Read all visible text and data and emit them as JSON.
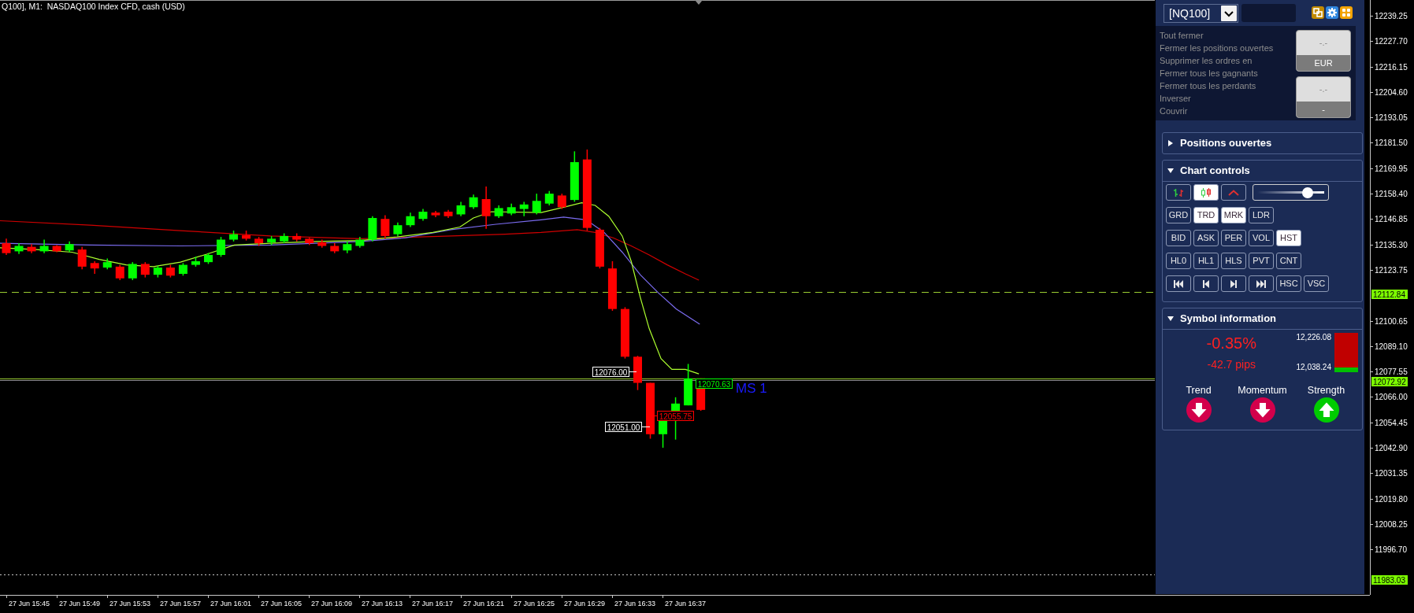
{
  "chart": {
    "title": "Q100], M1:  NASDAQ100 Index CFD, cash (USD)",
    "tags": [
      {
        "text": "12076.00",
        "color": "#ffffff"
      },
      {
        "text": "12051.00",
        "color": "#ffffff"
      },
      {
        "text": "12055.75",
        "color": "#ff0000"
      },
      {
        "text": "12070.63",
        "color": "#00ff00"
      }
    ],
    "line_label": "MS 1",
    "levels": [
      {
        "kind": "dashed",
        "marker": "12112.84"
      },
      {
        "kind": "solid",
        "marker": "12072.92"
      },
      {
        "kind": "dotted",
        "marker": "11983.03"
      }
    ],
    "price_ticks": [
      "12239.25",
      "12227.70",
      "12216.15",
      "12204.60",
      "12193.05",
      "12181.50",
      "12169.95",
      "12158.40",
      "12146.85",
      "12135.30",
      "12123.75",
      "12100.65",
      "12089.10",
      "12077.55",
      "12066.00",
      "12054.45",
      "12042.90",
      "12031.35",
      "12019.80",
      "12008.25",
      "11996.70"
    ],
    "time_ticks": [
      "27 Jun 15:45",
      "27 Jun 15:49",
      "27 Jun 15:53",
      "27 Jun 15:57",
      "27 Jun 16:01",
      "27 Jun 16:05",
      "27 Jun 16:09",
      "27 Jun 16:13",
      "27 Jun 16:17",
      "27 Jun 16:21",
      "27 Jun 16:25",
      "27 Jun 16:29",
      "27 Jun 16:33",
      "27 Jun 16:37"
    ]
  },
  "panel": {
    "symbol": "[NQ100]",
    "actions": [
      "Tout fermer",
      "Fermer les positions ouvertes",
      "Supprimer les ordres en",
      "Fermer tous les gagnants",
      "Fermer tous les perdants",
      "Inverser",
      "Couvrir"
    ],
    "amount_buttons": [
      {
        "value": "-.-",
        "caption": "EUR"
      },
      {
        "value": "-.-",
        "caption": "-"
      }
    ],
    "positions": {
      "title": "Positions ouvertes",
      "expanded": false
    },
    "chart_controls": {
      "title": "Chart controls",
      "expanded": true,
      "chart_types": [
        {
          "kind": "bars",
          "selected": false
        },
        {
          "kind": "candles",
          "selected": true
        },
        {
          "kind": "line",
          "selected": false
        }
      ],
      "zoom": {
        "level": 0.75
      },
      "toggle_rows": [
        [
          {
            "label": "GRD",
            "selected": false
          },
          {
            "label": "TRD",
            "selected": true
          },
          {
            "label": "MRK",
            "selected": true
          },
          {
            "label": "LDR",
            "selected": false
          }
        ],
        [
          {
            "label": "BID",
            "selected": false
          },
          {
            "label": "ASK",
            "selected": false
          },
          {
            "label": "PER",
            "selected": false
          },
          {
            "label": "VOL",
            "selected": false
          },
          {
            "label": "HST",
            "selected": true
          }
        ],
        [
          {
            "label": "HL0",
            "selected": false
          },
          {
            "label": "HL1",
            "selected": false
          },
          {
            "label": "HLS",
            "selected": false
          },
          {
            "label": "PVT",
            "selected": false
          },
          {
            "label": "CNT",
            "selected": false
          }
        ]
      ],
      "navigation": [
        {
          "kind": "first"
        },
        {
          "kind": "previous"
        },
        {
          "kind": "next"
        },
        {
          "kind": "last"
        }
      ],
      "scale_toggles": [
        {
          "label": "HSC",
          "selected": false
        },
        {
          "label": "VSC",
          "selected": false
        }
      ]
    },
    "symbol_info": {
      "title": "Symbol information",
      "expanded": true,
      "change": "-0.35%",
      "pips": "-42.7 pips",
      "rising": false,
      "high": "12,226.08",
      "low": "12,038.24",
      "level": 0.12,
      "signals": [
        {
          "label": "Trend",
          "rising": false
        },
        {
          "label": "Momentum",
          "rising": false
        },
        {
          "label": "Strength",
          "rising": true
        }
      ]
    }
  }
}
